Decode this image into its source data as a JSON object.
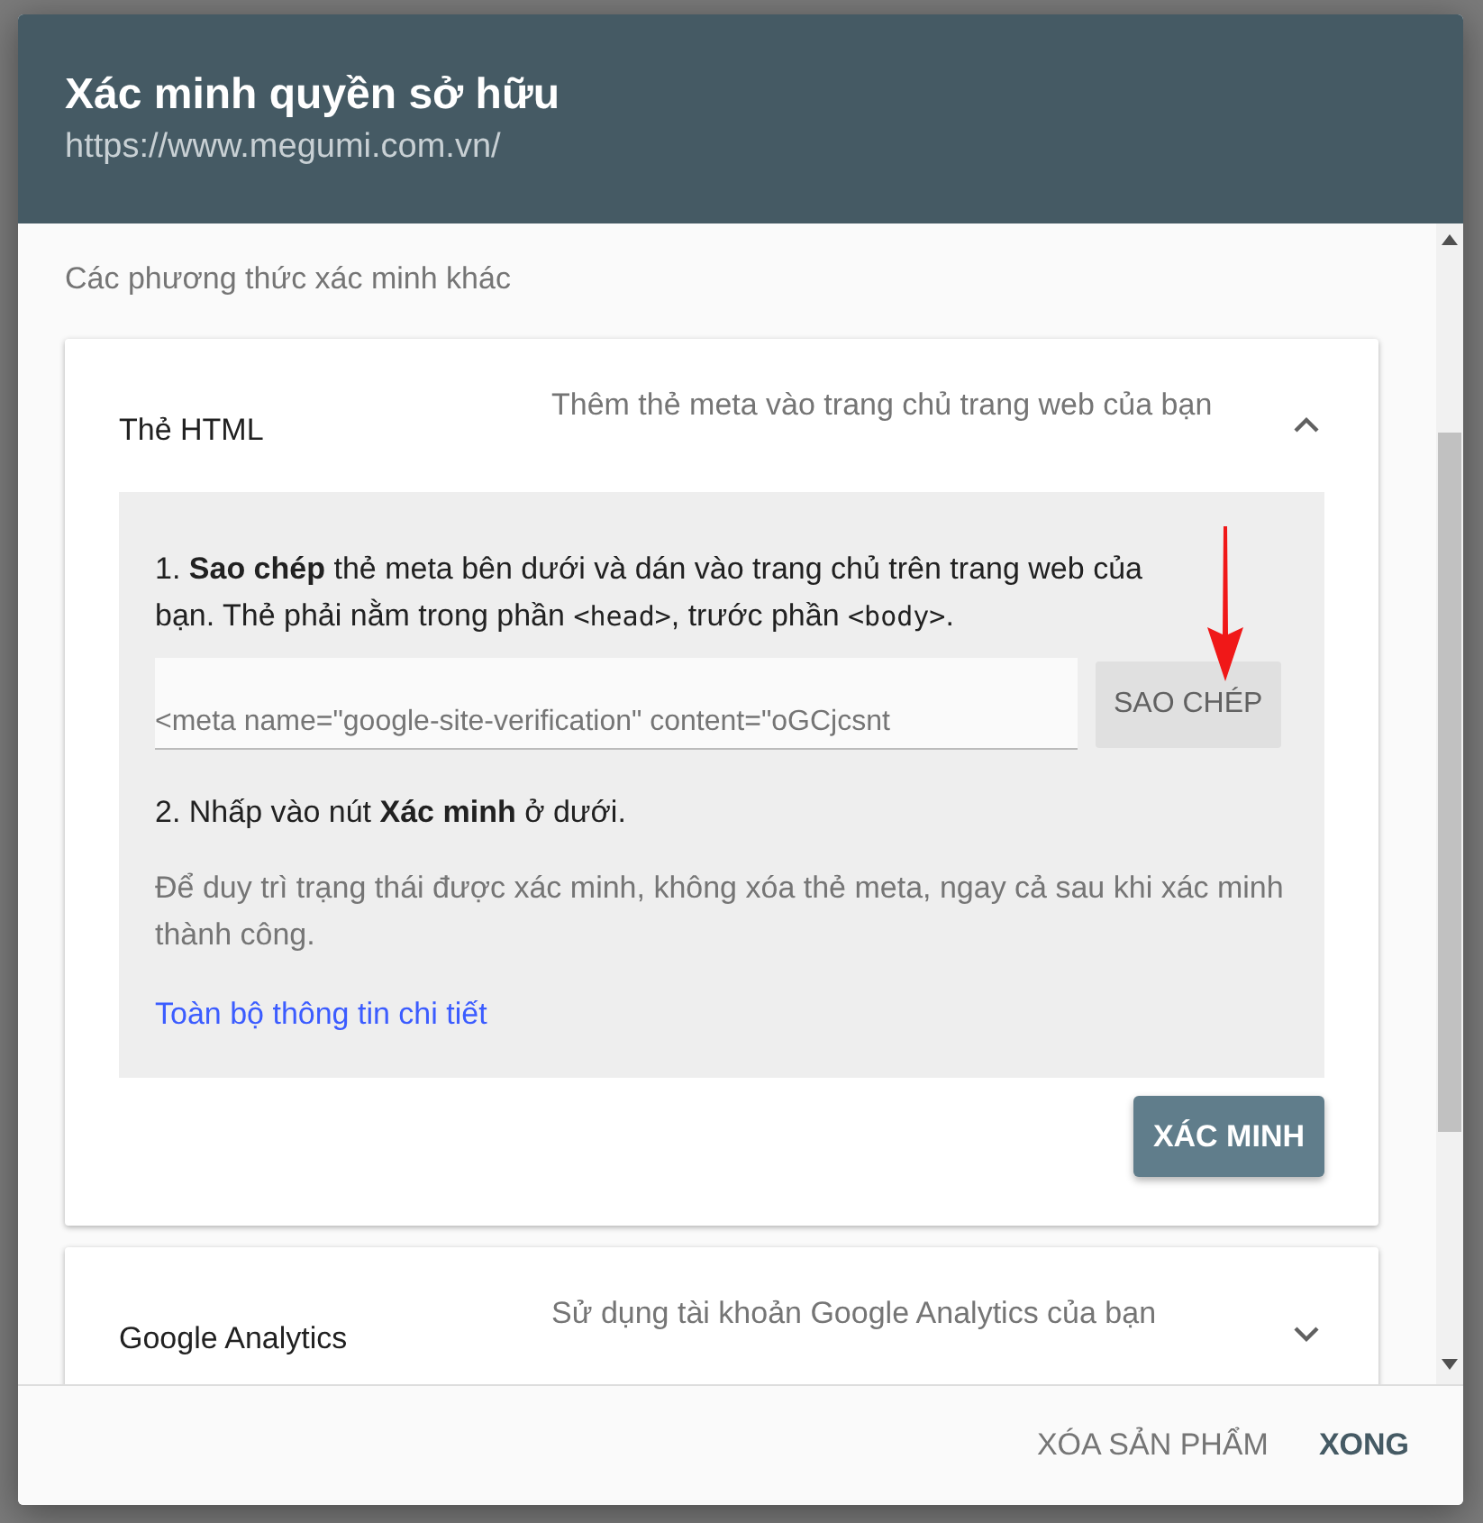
{
  "dialog": {
    "title": "Xác minh quyền sở hữu",
    "subtitle": "https://www.megumi.com.vn/"
  },
  "section_heading": "Các phương thức xác minh khác",
  "methods": [
    {
      "name": "Thẻ HTML",
      "description": "Thêm thẻ meta vào trang chủ trang web của bạn",
      "expanded": true,
      "step_1": [
        {
          "kind": "text",
          "text": "1. **Sao chép** thẻ meta bên dưới và dán vào trang chủ trên trang web của bạn. Thẻ phải nằm trong phần "
        },
        {
          "kind": "code",
          "text": "<head>"
        },
        {
          "kind": "text",
          "text": ", trước phần "
        },
        {
          "kind": "code",
          "text": "<body>"
        },
        {
          "kind": "text",
          "text": "."
        }
      ],
      "meta_tag": "<meta name=\"google-site-verification\" content=\"oGCjcsnt",
      "copy_button": "SAO CHÉP",
      "step_2": "2. Nhấp vào nút **Xác minh** ở dưới.",
      "note": "Để duy trì trạng thái được xác minh, không xóa thẻ meta, ngay cả sau khi xác minh thành công.",
      "details_link": "Toàn bộ thông tin chi tiết",
      "verify_button": "XÁC MINH"
    },
    {
      "name": "Google Analytics",
      "description": "Sử dụng tài khoản Google Analytics của bạn",
      "expanded": false
    }
  ],
  "footer": {
    "buttons": [
      {
        "label": "XÓA SẢN PHẨM",
        "kind": "secondary"
      },
      {
        "label": "XONG",
        "kind": "primary"
      }
    ]
  }
}
